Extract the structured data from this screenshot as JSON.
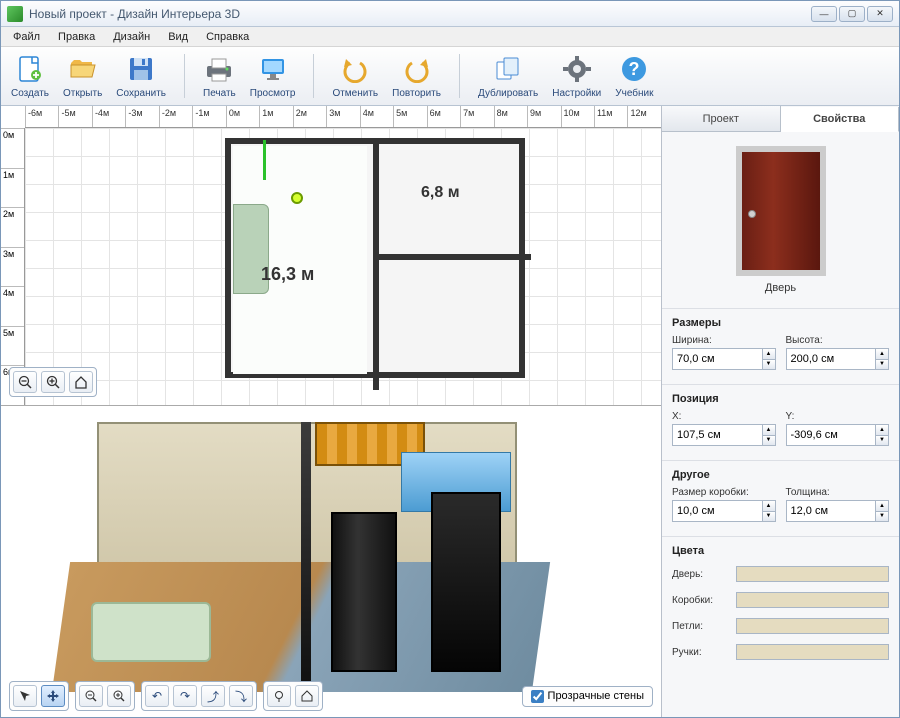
{
  "window_title": "Новый проект - Дизайн Интерьера 3D",
  "menus": [
    "Файл",
    "Правка",
    "Дизайн",
    "Вид",
    "Справка"
  ],
  "toolbar": [
    {
      "id": "create",
      "label": "Создать"
    },
    {
      "id": "open",
      "label": "Открыть"
    },
    {
      "id": "save",
      "label": "Сохранить"
    },
    {
      "id": "print",
      "label": "Печать"
    },
    {
      "id": "preview",
      "label": "Просмотр"
    },
    {
      "id": "undo",
      "label": "Отменить"
    },
    {
      "id": "redo",
      "label": "Повторить"
    },
    {
      "id": "duplicate",
      "label": "Дублировать"
    },
    {
      "id": "settings",
      "label": "Настройки"
    },
    {
      "id": "tutorial",
      "label": "Учебник"
    }
  ],
  "ruler_h": [
    "-6м",
    "-5м",
    "-4м",
    "-3м",
    "-2м",
    "-1м",
    "0м",
    "1м",
    "2м",
    "3м",
    "4м",
    "5м",
    "6м",
    "7м",
    "8м",
    "9м",
    "10м",
    "11м",
    "12м"
  ],
  "ruler_v": [
    "0м",
    "1м",
    "2м",
    "3м",
    "4м",
    "5м",
    "6м"
  ],
  "room_area_1": "16,3 м",
  "room_area_2": "6,8 м",
  "tabs": {
    "project": "Проект",
    "properties": "Свойства"
  },
  "preview_label": "Дверь",
  "sections": {
    "sizes": {
      "title": "Размеры",
      "width_label": "Ширина:",
      "height_label": "Высота:",
      "width": "70,0 см",
      "height": "200,0 см"
    },
    "position": {
      "title": "Позиция",
      "x_label": "X:",
      "y_label": "Y:",
      "x": "107,5 см",
      "y": "-309,6 см"
    },
    "other": {
      "title": "Другое",
      "frame_label": "Размер коробки:",
      "thick_label": "Толщина:",
      "frame": "10,0 см",
      "thick": "12,0 см"
    },
    "colors": {
      "title": "Цвета",
      "door": "Дверь:",
      "frame": "Коробки:",
      "hinges": "Петли:",
      "handles": "Ручки:"
    }
  },
  "transparent_walls_label": "Прозрачные стены",
  "color_swatches": {
    "door": "#e3d9bc",
    "frame": "#e3d9bc",
    "hinges": "#e3d9bc",
    "handles": "#e3d9bc"
  }
}
